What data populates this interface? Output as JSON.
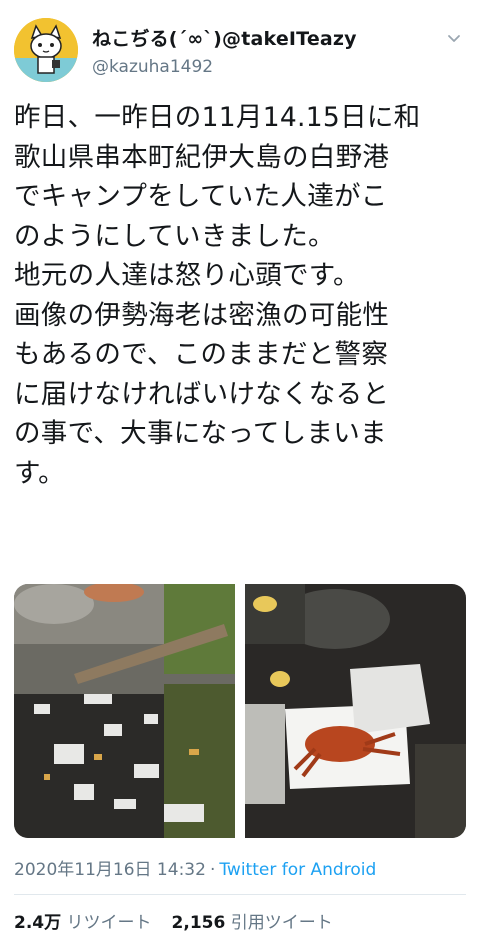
{
  "author": {
    "display_name": "ねこぢる(ˊ∞ˋ)@takeITeazy",
    "handle": "@kazuha1492"
  },
  "tweet": {
    "lines": [
      "昨日、一昨日の11月14.15日に和",
      "歌山県串本町紀伊大島の白野港",
      "でキャンプをしていた人達がこ",
      "のようにしていきました。",
      "地元の人達は怒り心頭です。",
      "画像の伊勢海老は密漁の可能性",
      "もあるので、このままだと警察",
      "に届けなければいけなくなると",
      "の事で、大事になってしまいま",
      "す。"
    ]
  },
  "meta": {
    "timestamp": "2020年11月16日 14:32",
    "separator": "·",
    "source": "Twitter for Android"
  },
  "stats": {
    "retweets_count": "2.4万",
    "retweets_label": "リツイート",
    "quotes_count": "2,156",
    "quotes_label": "引用ツイート"
  },
  "icons": {
    "menu": "chevron-down-icon",
    "avatar": "cat-avatar"
  },
  "colors": {
    "link": "#1da1f2",
    "secondary_text": "#657786",
    "avatar_bg": "#f2c230"
  }
}
